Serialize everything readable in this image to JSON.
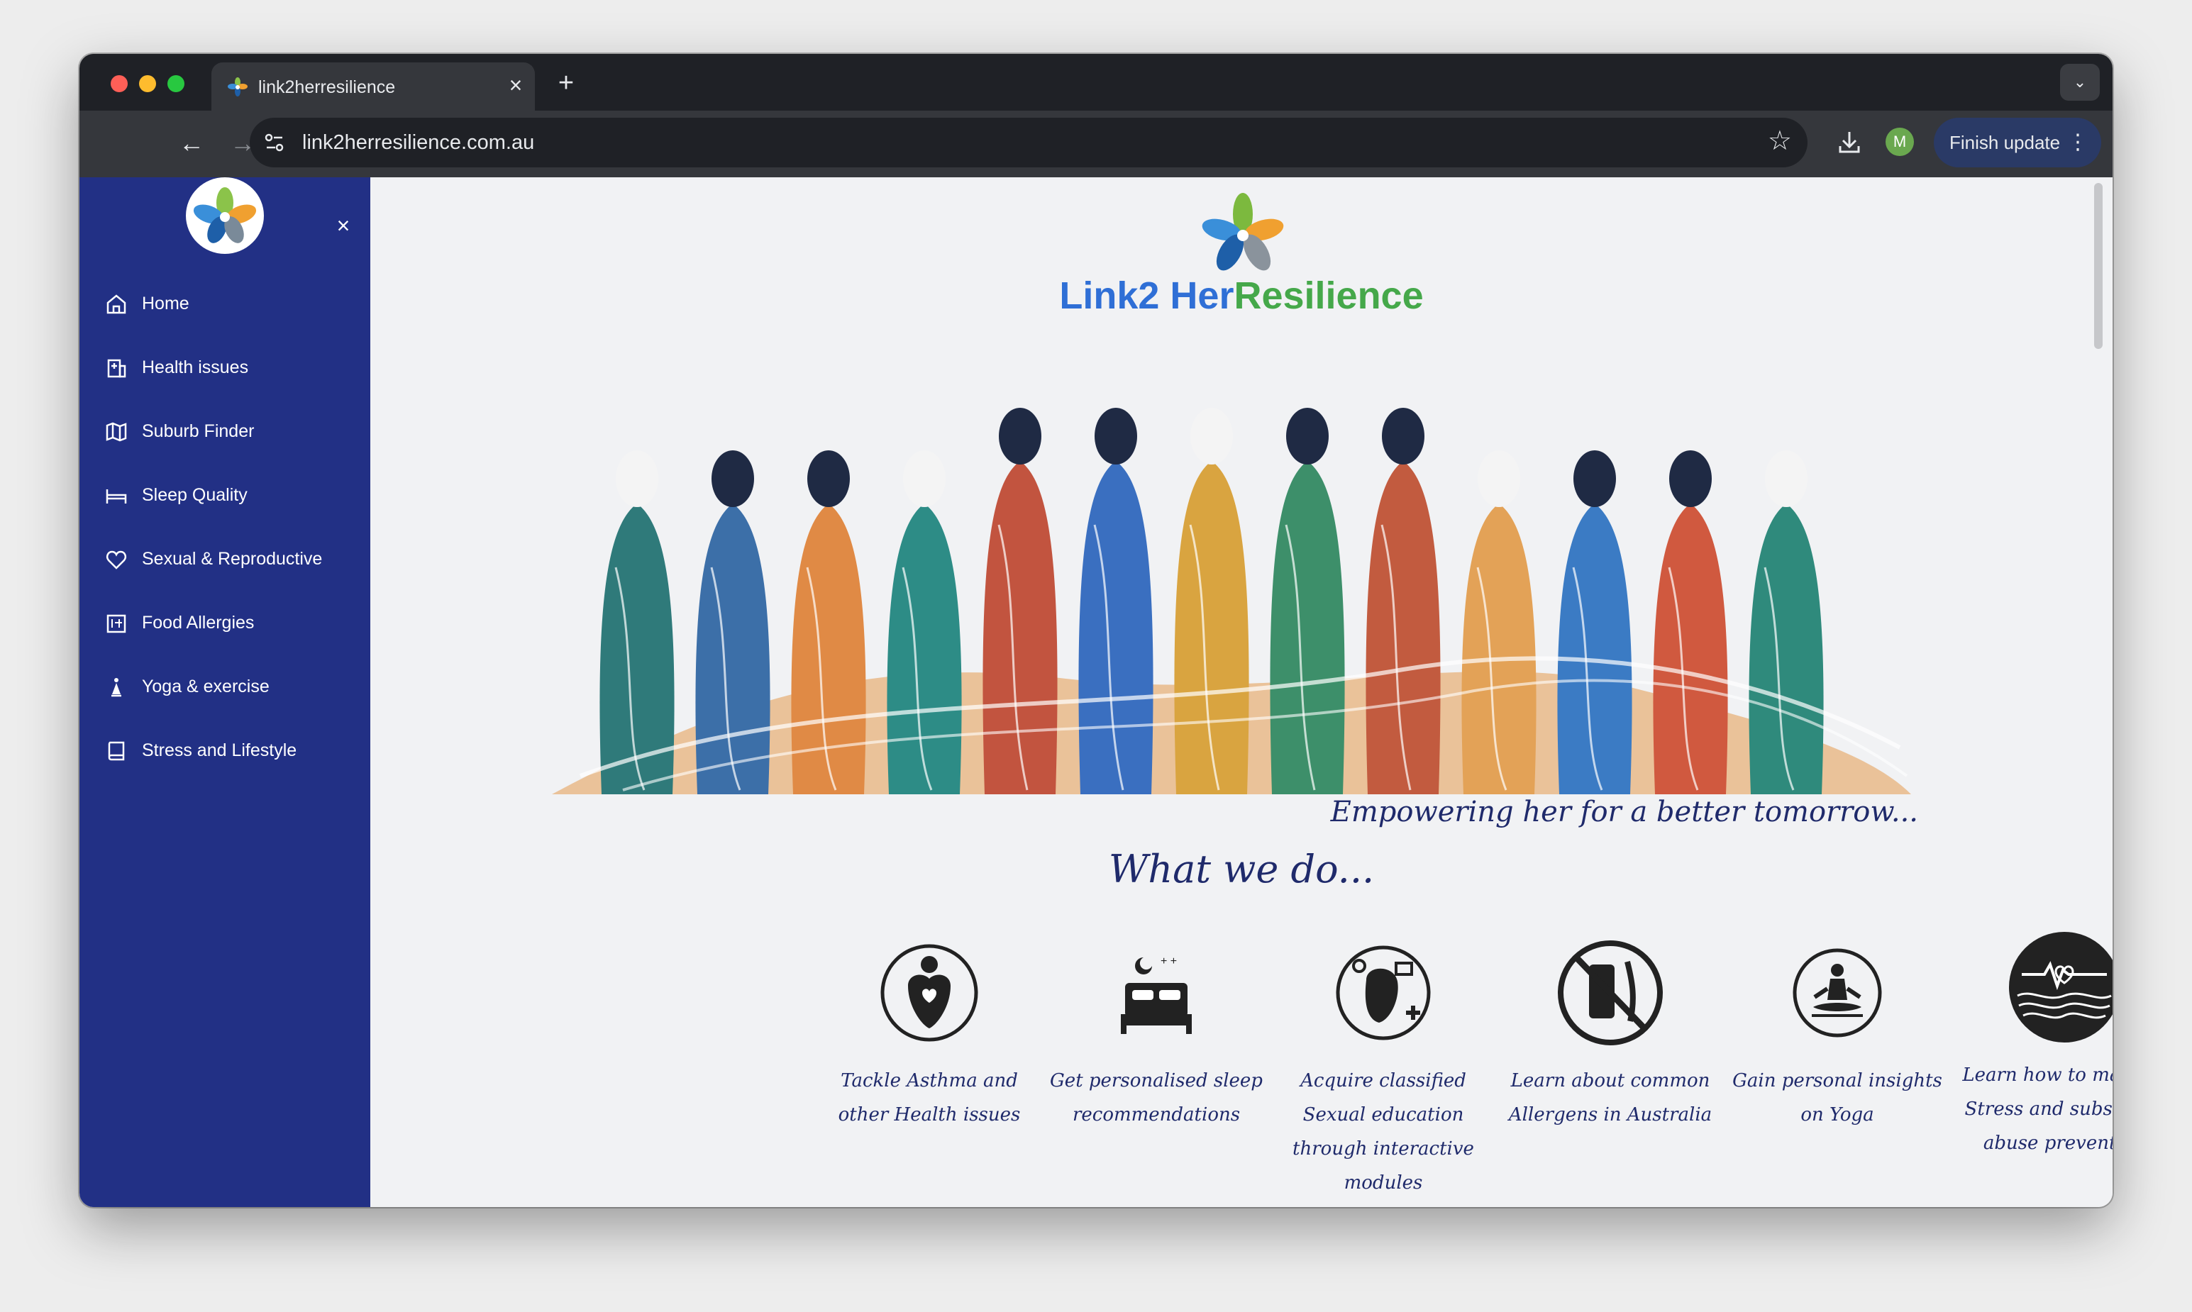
{
  "browser": {
    "tab_title": "link2herresilience",
    "tab_close": "×",
    "new_tab": "+",
    "tab_menu": "⌄",
    "url": "link2herresilience.com.au",
    "back": "←",
    "forward": "→",
    "reload": "↻",
    "star": "☆",
    "profile_initial": "M",
    "finish_update": "Finish update",
    "menu_dots": "⋮"
  },
  "sidebar": {
    "close": "×",
    "items": [
      {
        "label": "Home",
        "icon": "home-icon"
      },
      {
        "label": "Health issues",
        "icon": "hospital-icon"
      },
      {
        "label": "Suburb Finder",
        "icon": "map-icon"
      },
      {
        "label": "Sleep Quality",
        "icon": "bed-icon"
      },
      {
        "label": "Sexual & Reproductive",
        "icon": "heart-icon"
      },
      {
        "label": "Food Allergies",
        "icon": "food-icon"
      },
      {
        "label": "Yoga & exercise",
        "icon": "yoga-icon"
      },
      {
        "label": "Stress and Lifestyle",
        "icon": "book-icon"
      }
    ]
  },
  "main": {
    "brand_part1": "Link2 ",
    "brand_part2": "Her",
    "brand_part3": "Resilience",
    "tagline": "Empowering her for a better tomorrow...",
    "section_title": "What we do...",
    "services": [
      {
        "label": "Tackle Asthma and other Health issues",
        "icon": "asthma-icon"
      },
      {
        "label": "Get personalised sleep recommendations",
        "icon": "sleep-bed-icon"
      },
      {
        "label": "Acquire classified Sexual education through interactive modules",
        "icon": "sexual-education-icon"
      },
      {
        "label": "Learn about common Allergens in Australia",
        "icon": "allergen-icon"
      },
      {
        "label": "Gain personal insights on Yoga",
        "icon": "meditation-icon"
      },
      {
        "label": "Learn how to manage Stress and substance abuse prevention",
        "icon": "stress-wave-icon"
      }
    ]
  },
  "colors": {
    "sidebar": "#223085",
    "brand_blue": "#2f6fd6",
    "brand_green": "#45a84a",
    "heading_navy": "#1f2a6b"
  }
}
